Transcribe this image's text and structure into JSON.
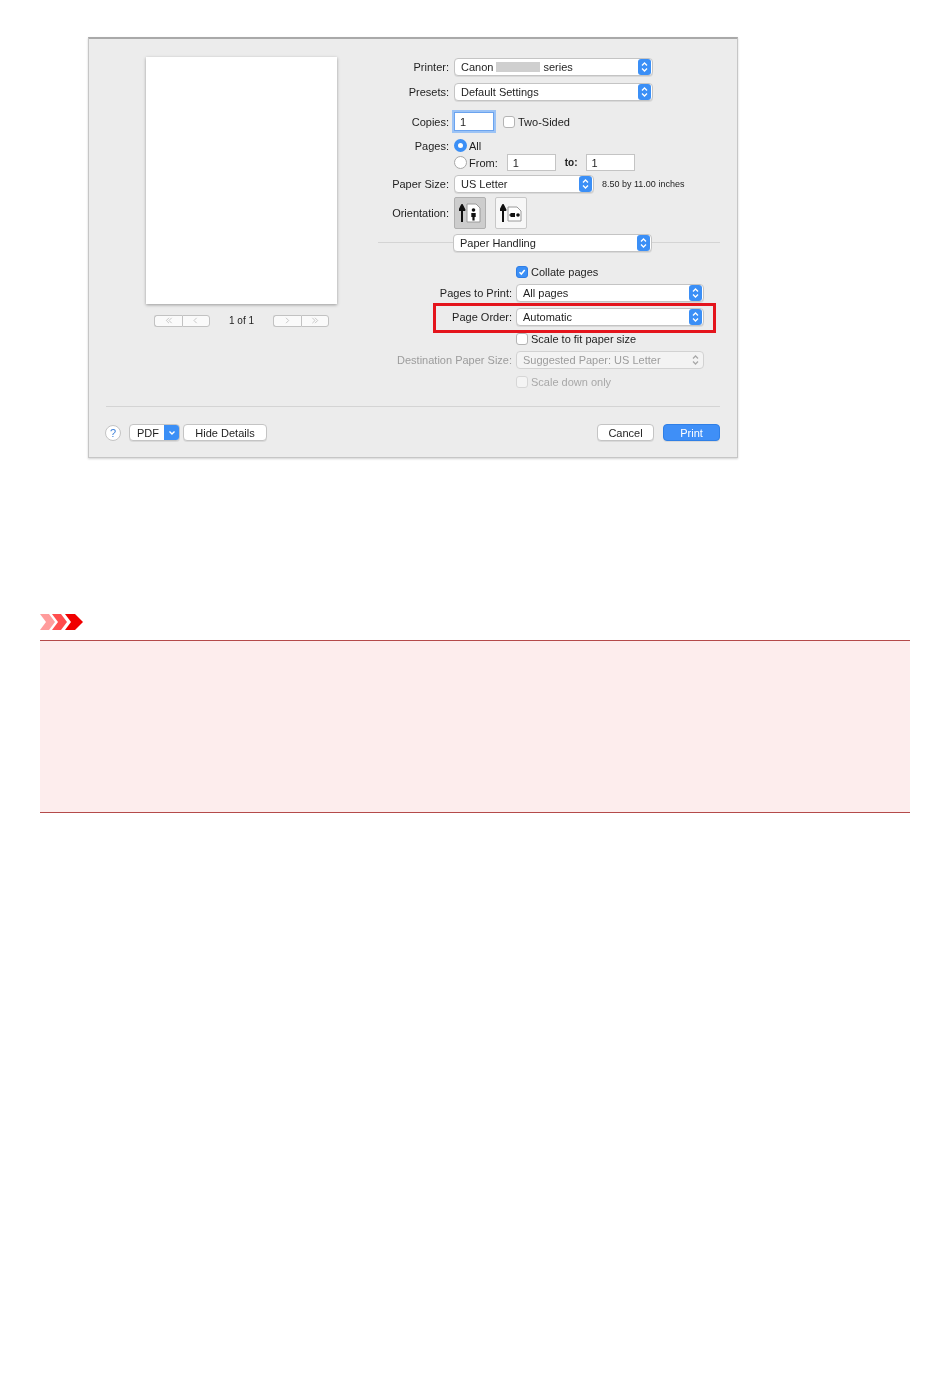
{
  "preview": {
    "page_count": "1 of 1",
    "nav_buttons": [
      {
        "kind": "first",
        "disabled": true
      },
      {
        "kind": "previous",
        "disabled": true
      },
      {
        "kind": "next",
        "disabled": true
      },
      {
        "kind": "last",
        "disabled": true
      }
    ]
  },
  "printer": {
    "label": "Printer:",
    "value_before": "Canon",
    "redacted": true,
    "value_after": "series"
  },
  "presets": {
    "label": "Presets:",
    "value": "Default Settings"
  },
  "copies": {
    "label": "Copies:",
    "value": "1",
    "focused": true,
    "two_sided": {
      "label": "Two-Sided",
      "checked": false
    }
  },
  "pages": {
    "label": "Pages:",
    "options": [
      {
        "label": "All",
        "selected": true
      },
      {
        "label": "From:",
        "selected": false
      }
    ],
    "from": "1",
    "to_label": "to:",
    "to": "1"
  },
  "paper_size": {
    "label": "Paper Size:",
    "value": "US Letter",
    "dimensions": "8.50 by 11.00 inches"
  },
  "orientation": {
    "label": "Orientation:",
    "options": [
      {
        "kind": "portrait",
        "selected": true
      },
      {
        "kind": "landscape",
        "selected": false
      }
    ]
  },
  "panel_menu": {
    "value": "Paper Handling"
  },
  "paper_handling": [
    {
      "kind": "checkbox",
      "label": "Collate pages",
      "checked": true,
      "disabled": false
    },
    {
      "kind": "popup",
      "label": "Pages to Print:",
      "value": "All pages",
      "disabled": false,
      "highlighted": false
    },
    {
      "kind": "popup",
      "label": "Page Order:",
      "value": "Automatic",
      "disabled": false,
      "highlighted": true
    },
    {
      "kind": "checkbox",
      "label": "Scale to fit paper size",
      "checked": false,
      "disabled": false
    },
    {
      "kind": "popup",
      "label": "Destination Paper Size:",
      "value": "Suggested Paper: US Letter",
      "disabled": true,
      "highlighted": false
    },
    {
      "kind": "checkbox",
      "label": "Scale down only",
      "checked": false,
      "disabled": true
    }
  ],
  "footer": {
    "help": "?",
    "pdf": "PDF",
    "details": "Hide Details",
    "cancel": "Cancel",
    "print": "Print"
  },
  "notice": {
    "kind": "important"
  }
}
